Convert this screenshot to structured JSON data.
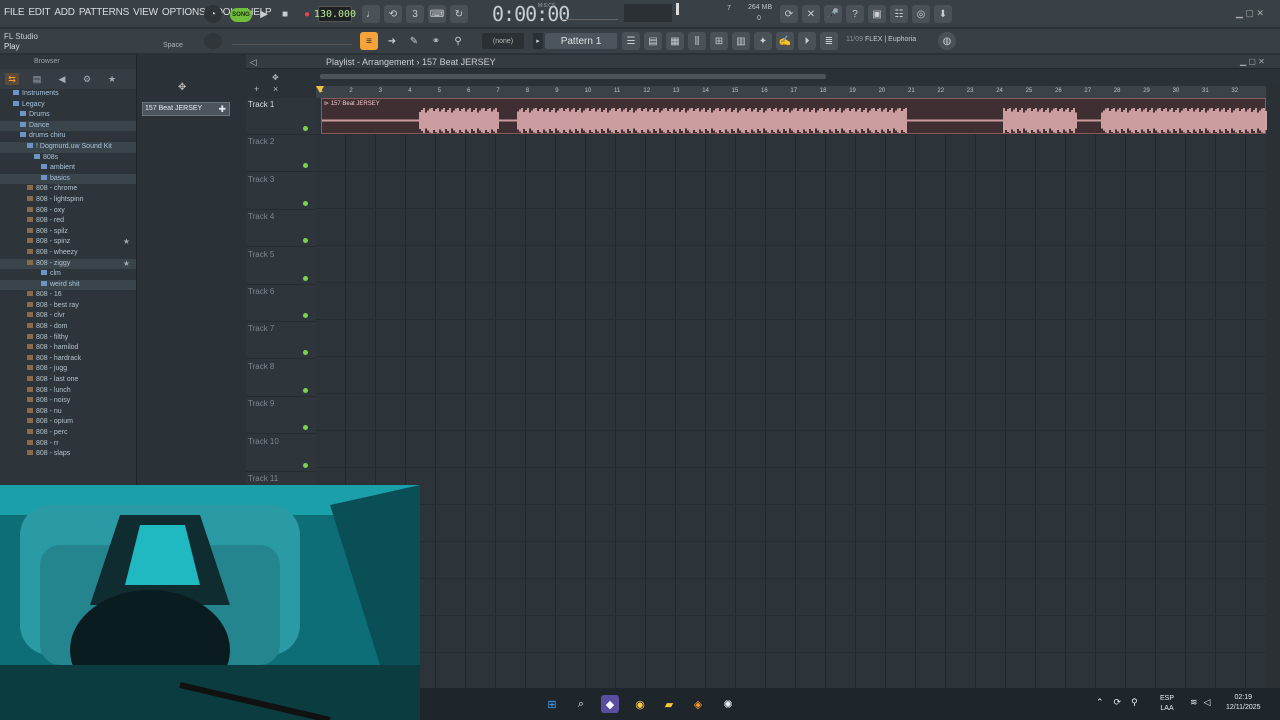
{
  "menu": [
    "FILE",
    "EDIT",
    "ADD",
    "PATTERNS",
    "VIEW",
    "OPTIONS",
    "TOOLS",
    "HELP"
  ],
  "transport": {
    "mode_label": "SONG",
    "tempo": "130.000",
    "time": "0:00:00",
    "time_unit": "M:S:CS"
  },
  "monitor": {
    "cpu": "7",
    "memory": "264 MB",
    "polyphony": "0"
  },
  "hint": {
    "title": "FL Studio",
    "text": "Play",
    "shortcut": "Space"
  },
  "pattern": {
    "none_label": "(none)",
    "selected": "Pattern 1"
  },
  "plugin_info": {
    "count": "11/09",
    "name": "FLEX | Euphoria"
  },
  "browser": {
    "title": "Browser",
    "items": [
      {
        "label": "Instruments",
        "type": "fold",
        "indent": 1
      },
      {
        "label": "Legacy",
        "type": "fold",
        "indent": 1
      },
      {
        "label": "Drums",
        "type": "fold",
        "indent": 2
      },
      {
        "label": "Dance",
        "type": "fold",
        "indent": 2
      },
      {
        "label": "drums chiru",
        "type": "fold",
        "indent": 2
      },
      {
        "label": "! Dogmurd.uw Sound Kit",
        "type": "fold",
        "indent": 3
      },
      {
        "label": "808s",
        "type": "fold",
        "indent": 4
      },
      {
        "label": "ambient",
        "type": "fold",
        "indent": 5
      },
      {
        "label": "basics",
        "type": "fold",
        "indent": 5
      },
      {
        "label": "808 - chrome",
        "type": "file",
        "indent": 3
      },
      {
        "label": "808 - lightspinn",
        "type": "file",
        "indent": 3
      },
      {
        "label": "808 - oxy",
        "type": "file",
        "indent": 3
      },
      {
        "label": "808 - red",
        "type": "file",
        "indent": 3
      },
      {
        "label": "808 - spilz",
        "type": "file",
        "indent": 3
      },
      {
        "label": "808 - spinz",
        "type": "file",
        "indent": 3,
        "star": true
      },
      {
        "label": "808 - wheezy",
        "type": "file",
        "indent": 3
      },
      {
        "label": "808 - ziggy",
        "type": "file",
        "indent": 3,
        "star": true
      },
      {
        "label": "clm",
        "type": "fold",
        "indent": 5
      },
      {
        "label": "weird shit",
        "type": "fold",
        "indent": 5
      },
      {
        "label": "808 - 16",
        "type": "file",
        "indent": 3
      },
      {
        "label": "808 - best ray",
        "type": "file",
        "indent": 3
      },
      {
        "label": "808 - clvr",
        "type": "file",
        "indent": 3
      },
      {
        "label": "808 - dom",
        "type": "file",
        "indent": 3
      },
      {
        "label": "808 - filthy",
        "type": "file",
        "indent": 3
      },
      {
        "label": "808 - hamilod",
        "type": "file",
        "indent": 3
      },
      {
        "label": "808 - hardrack",
        "type": "file",
        "indent": 3
      },
      {
        "label": "808 - jugg",
        "type": "file",
        "indent": 3
      },
      {
        "label": "808 - last one",
        "type": "file",
        "indent": 3
      },
      {
        "label": "808 - lunch",
        "type": "file",
        "indent": 3
      },
      {
        "label": "808 - noisy",
        "type": "file",
        "indent": 3
      },
      {
        "label": "808 - nu",
        "type": "file",
        "indent": 3
      },
      {
        "label": "808 - opium",
        "type": "file",
        "indent": 3
      },
      {
        "label": "808 - perc",
        "type": "file",
        "indent": 3
      },
      {
        "label": "808 - rr",
        "type": "file",
        "indent": 3
      },
      {
        "label": "808 - slaps",
        "type": "file",
        "indent": 3
      }
    ]
  },
  "playlist": {
    "title": "Playlist - Arrangement",
    "pattern_name": "157 Beat JERSEY",
    "picker_pattern": "157 Beat JERSEY",
    "clip_label": "157 Beat JERSEY",
    "tracks": [
      "Track 1",
      "Track 2",
      "Track 3",
      "Track 4",
      "Track 5",
      "Track 6",
      "Track 7",
      "Track 8",
      "Track 9",
      "Track 10",
      "Track 11"
    ],
    "bars": [
      "1",
      "2",
      "3",
      "4",
      "5",
      "6",
      "7",
      "8",
      "9",
      "10",
      "11",
      "12",
      "13",
      "14",
      "15",
      "16",
      "17",
      "18",
      "19",
      "20",
      "21",
      "22",
      "23",
      "24",
      "25",
      "26",
      "27",
      "28",
      "29",
      "30",
      "31",
      "32"
    ]
  },
  "taskbar": {
    "lang_top": "ESP",
    "lang_bottom": "LAA",
    "time": "02:19",
    "date": "12/11/2025"
  },
  "colors": {
    "accent": "#f5a33a",
    "song_mode": "#6fbd3a",
    "clip_wave": "#f0b9bb",
    "track_dot": "#7bd24b"
  }
}
